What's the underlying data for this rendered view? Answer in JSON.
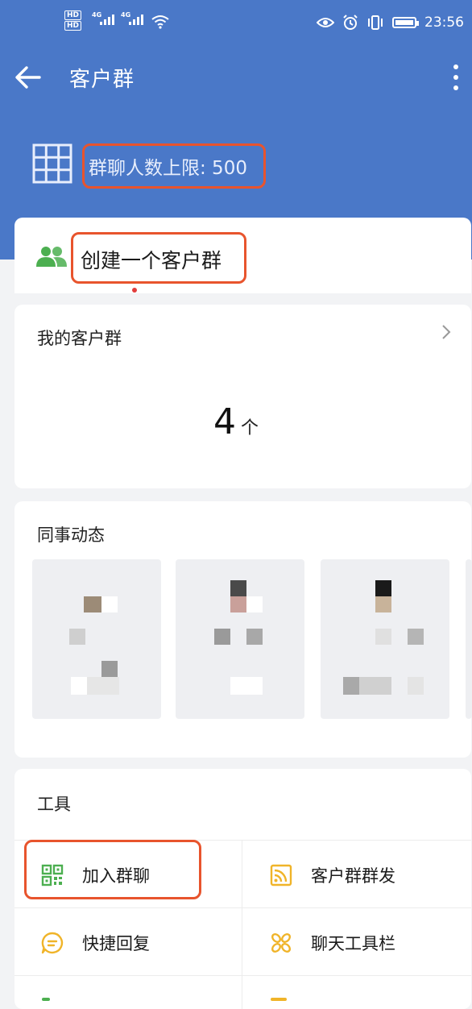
{
  "status_bar": {
    "hd1": "HD",
    "hd2": "HD",
    "net1": "4G",
    "net2": "4G",
    "time": "23:56"
  },
  "app_bar": {
    "title": "客户群"
  },
  "group_limit": {
    "label": "群聊人数上限: 500"
  },
  "create_group": {
    "label": "创建一个客户群"
  },
  "my_groups": {
    "title": "我的客户群",
    "count": "4",
    "unit": "个"
  },
  "colleague_activity": {
    "title": "同事动态"
  },
  "tools": {
    "title": "工具",
    "items": [
      {
        "label": "加入群聊",
        "icon": "qr-code-icon"
      },
      {
        "label": "客户群群发",
        "icon": "broadcast-icon"
      },
      {
        "label": "快捷回复",
        "icon": "chat-bubble-icon"
      },
      {
        "label": "聊天工具栏",
        "icon": "toolbar-icon"
      }
    ]
  },
  "colors": {
    "header_blue": "#4a78c8",
    "highlight_red": "#e8542d",
    "icon_green": "#4caf50",
    "icon_yellow": "#f0b429"
  }
}
